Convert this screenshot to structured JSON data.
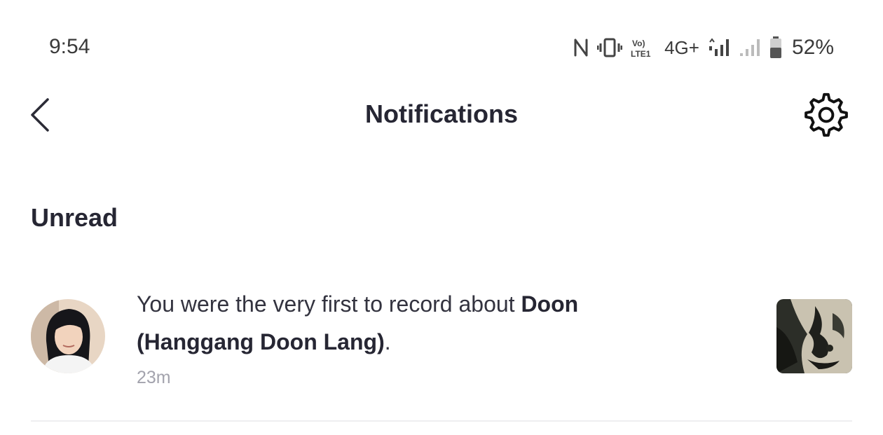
{
  "status_bar": {
    "time": "9:54",
    "network": "4G+",
    "volte_label": "Vo) LTE1",
    "battery": "52%",
    "battery_level": 0.52,
    "icons": [
      "nfc-icon",
      "vibrate-icon",
      "volte-icon",
      "signal-icon",
      "signal-weak-icon",
      "battery-icon"
    ]
  },
  "header": {
    "title": "Notifications",
    "back_icon": "chevron-left-icon",
    "settings_icon": "gear-icon"
  },
  "section": {
    "title": "Unread"
  },
  "notifications": [
    {
      "text_prefix": "You were the very first to record about ",
      "bold_line1": "Doon",
      "bold_line2": "(Hanggang Doon Lang)",
      "suffix": ".",
      "time": "23m"
    }
  ],
  "colors": {
    "title": "#262633",
    "body_text": "#33333f",
    "muted": "#a3a3ad",
    "divider": "#eeeef0"
  }
}
